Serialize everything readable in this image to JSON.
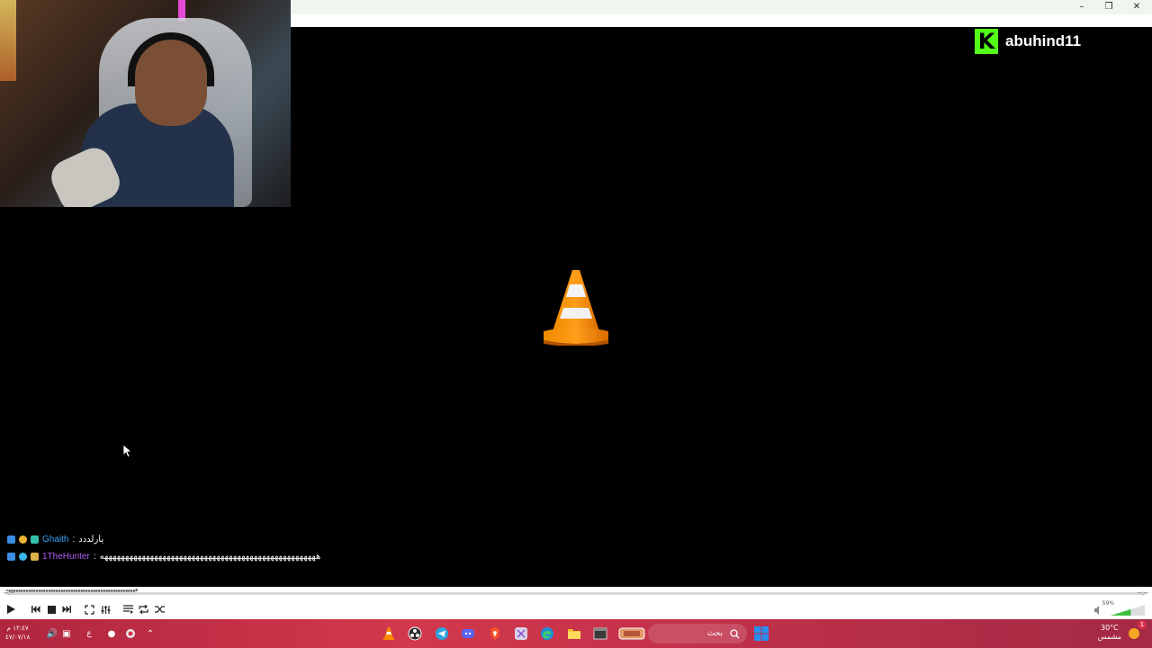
{
  "window": {
    "minimize_glyph": "–",
    "maximize_glyph": "❐",
    "close_glyph": "✕"
  },
  "overlay": {
    "kick_logo_letter": "K",
    "kick_username": "abuhind11",
    "brand_color": "#53fc18"
  },
  "chat": [
    {
      "username": "Ghaith",
      "separator": " :",
      "message": "يارلددد",
      "name_color": "#3aa7ff"
    },
    {
      "username": "1TheHunter",
      "separator": " :",
      "message": "ههههههههههههههههههههههههههههههههههههههههههههههههههههه",
      "name_color": "#b05cf5"
    }
  ],
  "player": {
    "time_elapsed": "--:--",
    "time_total": "--:--",
    "volume_percent": "59%",
    "volume_level": 0.59,
    "waveform_text": "ههههههههههههههههههههههههههههههههههههههههههههههههههههه"
  },
  "controls": {
    "play_icon": "play-icon",
    "prev_icon": "previous-icon",
    "stop_icon": "stop-icon",
    "next_icon": "next-icon",
    "fullscreen_icon": "fullscreen-icon",
    "extended_icon": "extended-settings-icon",
    "playlist_icon": "playlist-icon",
    "loop_icon": "loop-icon",
    "shuffle_icon": "shuffle-icon"
  },
  "taskbar": {
    "clock_time": "١٢:٤٧ م",
    "clock_date": "٤٧/٠٧/١٨",
    "language": "ع",
    "search_placeholder": "بحث",
    "weather_temp": "30°C",
    "weather_desc": "مشمس",
    "notification_count": "1"
  }
}
